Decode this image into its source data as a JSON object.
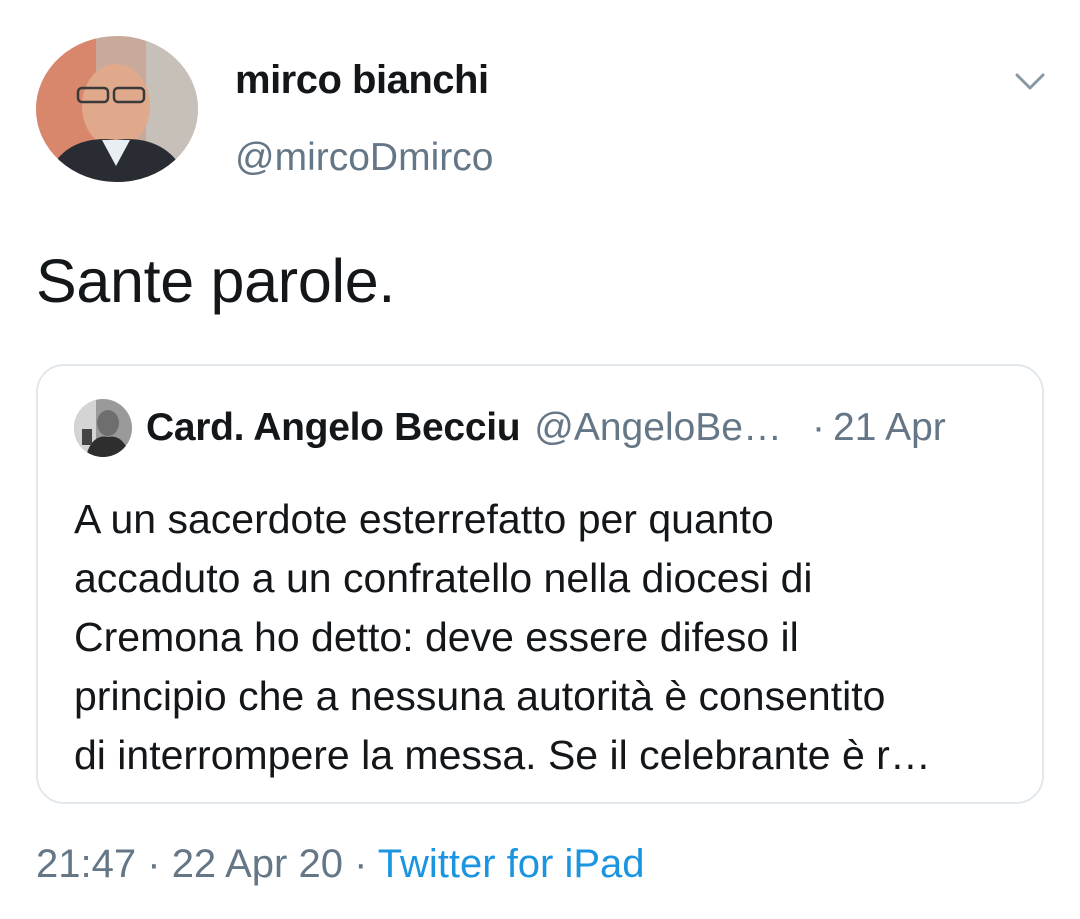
{
  "author": {
    "display_name": "mirco bianchi",
    "handle": "@mircoDmirco"
  },
  "tweet": {
    "text": "Sante parole."
  },
  "quoted_tweet": {
    "display_name": "Card. Angelo Becciu",
    "handle": "@AngeloBe…",
    "separator": "·",
    "date": "21 Apr",
    "lines": [
      "A un sacerdote esterrefatto per quanto",
      "accaduto a un confratello nella diocesi di",
      "Cremona ho detto: deve essere difeso il",
      "principio che a nessuna autorità è consentito",
      "di interrompere la messa. Se il celebrante è r…"
    ]
  },
  "meta": {
    "time": "21:47",
    "sep1": "·",
    "date": "22 Apr 20",
    "sep2": "·",
    "source": "Twitter for iPad"
  },
  "icons": {
    "more": "chevron-down-icon"
  },
  "colors": {
    "text": "#14171a",
    "secondary": "#657786",
    "link": "#1b95e0",
    "border": "#e1e8ed"
  }
}
